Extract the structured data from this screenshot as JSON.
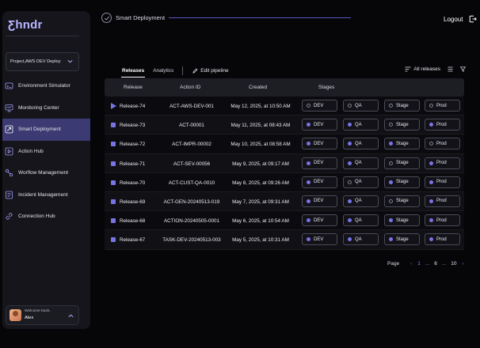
{
  "brand": {
    "logo": "Ƹhndr"
  },
  "sidebar": {
    "project": "Project,AWS DEV Deploy",
    "items": [
      {
        "label": "Environment Simulator",
        "icon": "simulator-icon",
        "active": false
      },
      {
        "label": "Monitoring Center",
        "icon": "monitor-icon",
        "active": false
      },
      {
        "label": "Smart Deployment",
        "icon": "deploy-icon",
        "active": true
      },
      {
        "label": "Action Hub",
        "icon": "play-icon",
        "active": false
      },
      {
        "label": "Worflow Management",
        "icon": "workflow-icon",
        "active": false
      },
      {
        "label": "Incident Management",
        "icon": "incident-icon",
        "active": false
      },
      {
        "label": "Connection Hub",
        "icon": "link-icon",
        "active": false
      }
    ],
    "user": {
      "welcome": "Welcome back,",
      "name": "Alex"
    }
  },
  "header": {
    "title": "Smart Deployment",
    "logout": "Logout"
  },
  "tabs": {
    "releases": "Releases",
    "analytics": "Analytics",
    "edit_pipeline": "Edit pipeline",
    "all_releases": "All releases"
  },
  "table": {
    "headers": {
      "release": "Release",
      "action_id": "Action ID",
      "created": "Created",
      "stages": "Stages"
    },
    "rows": [
      {
        "release": "Release-74",
        "action_id": "ACT-AWS-DEV-001",
        "created": "May 12, 2025, at 10:50 AM",
        "running": true,
        "stages": [
          {
            "name": "DEV",
            "done": false
          },
          {
            "name": "QA",
            "done": false
          },
          {
            "name": "Stage",
            "done": false
          },
          {
            "name": "Prod",
            "done": false
          }
        ]
      },
      {
        "release": "Release-73",
        "action_id": "ACT-00001",
        "created": "May 11, 2025, at 08:43 AM",
        "running": false,
        "stages": [
          {
            "name": "DEV",
            "done": true
          },
          {
            "name": "QA",
            "done": true
          },
          {
            "name": "Stage",
            "done": false
          },
          {
            "name": "Prod",
            "done": true
          }
        ]
      },
      {
        "release": "Release-72",
        "action_id": "ACT-IMPR-00002",
        "created": "May 10, 2025, at 08:58 AM",
        "running": false,
        "stages": [
          {
            "name": "DEV",
            "done": true
          },
          {
            "name": "QA",
            "done": true
          },
          {
            "name": "Stage",
            "done": true
          },
          {
            "name": "Prod",
            "done": false
          }
        ]
      },
      {
        "release": "Release-71",
        "action_id": "ACT-SEV-00056",
        "created": "May 9, 2025, at 09:17 AM",
        "running": false,
        "stages": [
          {
            "name": "DEV",
            "done": true
          },
          {
            "name": "QA",
            "done": true
          },
          {
            "name": "Stage",
            "done": false
          },
          {
            "name": "Prod",
            "done": true
          }
        ]
      },
      {
        "release": "Release-70",
        "action_id": "ACT-CUST-QA-0010",
        "created": "May 8, 2025, at 09:26 AM",
        "running": false,
        "stages": [
          {
            "name": "DEV",
            "done": true
          },
          {
            "name": "QA",
            "done": false
          },
          {
            "name": "Stage",
            "done": true
          },
          {
            "name": "Prod",
            "done": true
          }
        ]
      },
      {
        "release": "Release-69",
        "action_id": "ACT-GEN-20240513-019",
        "created": "May 7, 2025, at 09:31 AM",
        "running": false,
        "stages": [
          {
            "name": "DEV",
            "done": true
          },
          {
            "name": "QA",
            "done": true
          },
          {
            "name": "Stage",
            "done": false
          },
          {
            "name": "Prod",
            "done": true
          }
        ]
      },
      {
        "release": "Release-68",
        "action_id": "ACTION-20240505-0001",
        "created": "May 6, 2025, at 10:54 AM",
        "running": false,
        "stages": [
          {
            "name": "DEV",
            "done": true
          },
          {
            "name": "QA",
            "done": true
          },
          {
            "name": "Stage",
            "done": true
          },
          {
            "name": "Prod",
            "done": true
          }
        ]
      },
      {
        "release": "Release-67",
        "action_id": "TASK-DEV-20240513-003",
        "created": "May 5, 2025, at 10:31 AM",
        "running": false,
        "stages": [
          {
            "name": "DEV",
            "done": true
          },
          {
            "name": "QA",
            "done": true
          },
          {
            "name": "Stage",
            "done": true
          },
          {
            "name": "Prod",
            "done": true
          }
        ]
      }
    ]
  },
  "pagination": {
    "label": "Page",
    "prev": "‹",
    "next": "›",
    "pages": [
      "1",
      "...",
      "6",
      "...",
      "10"
    ],
    "current": "1"
  },
  "colors": {
    "accent": "#7874e6",
    "active_nav": "#3b3a72",
    "background": "#060609"
  }
}
